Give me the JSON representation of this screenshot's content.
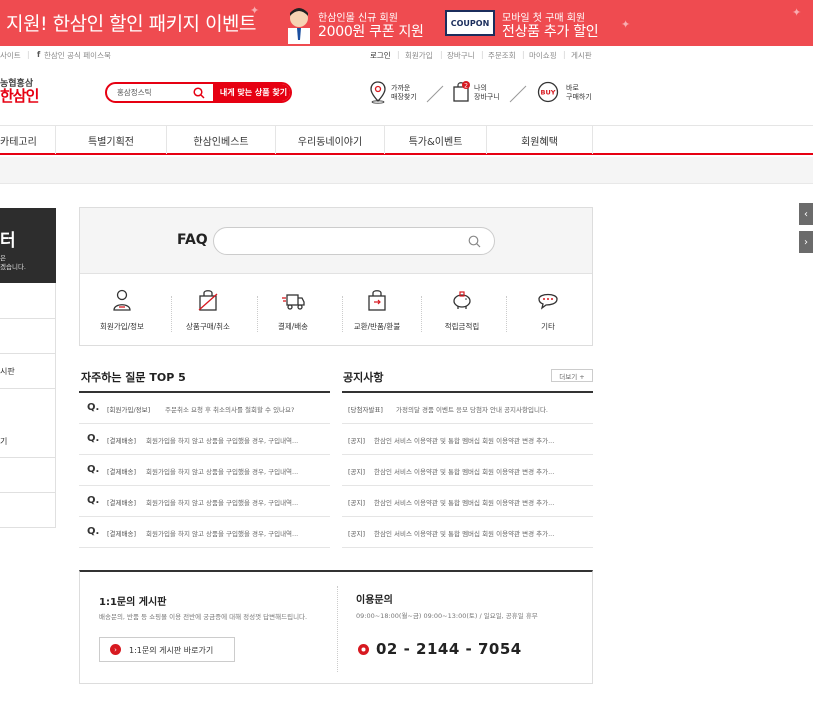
{
  "banner": {
    "title": "지원! 한삼인 할인 패키지 이벤트",
    "promo1_small": "한삼인몰 신규 회원",
    "promo1_big": "2000원 쿠폰 지원",
    "coupon_text": "COUPON",
    "promo2_small": "모바일 첫 구매 회원",
    "promo2_big": "전상품 추가 할인",
    "color": "#ef4b50"
  },
  "util": {
    "left1": "사이트",
    "left2": "한삼인 공식 페이스북",
    "right": [
      "로그인",
      "회원가입",
      "장바구니",
      "주문조회",
      "마이쇼핑",
      "게시판"
    ]
  },
  "logo": {
    "line1": "농협홍삼",
    "line2": "한삼인"
  },
  "search": {
    "keyword": "홍삼정스틱",
    "button": "내게 맞는 상품 찾기"
  },
  "header_icons": [
    {
      "icon": "location-pin-icon",
      "label1": "가까운",
      "label2": "매장찾기"
    },
    {
      "icon": "cart-icon",
      "label1": "나의",
      "label2": "장바구니",
      "badge": "2"
    },
    {
      "icon": "buy-bag-icon",
      "label1": "바로",
      "label2": "구매하기",
      "icon_text": "BUY"
    }
  ],
  "nav": [
    "카테고리",
    "특별기획전",
    "한삼인베스트",
    "우리동네이야기",
    "특가&이벤트",
    "회원혜택"
  ],
  "sidebar": {
    "title": "터",
    "sub1": "은",
    "sub2": "겠습니다.",
    "items": [
      "",
      "",
      "시판",
      "기",
      "",
      ""
    ]
  },
  "faq": {
    "label": "FAQ",
    "categories": [
      {
        "icon": "person-icon",
        "label": "회원가입/정보"
      },
      {
        "icon": "shopping-bag-cancel-icon",
        "label": "상품구매/취소"
      },
      {
        "icon": "delivery-truck-icon",
        "label": "결제/배송"
      },
      {
        "icon": "exchange-bag-icon",
        "label": "교환/반품/환불"
      },
      {
        "icon": "piggy-bank-icon",
        "label": "적립금적립"
      },
      {
        "icon": "speech-bubble-icon",
        "label": "기타"
      }
    ]
  },
  "top5": {
    "title": "자주하는 질문 TOP 5",
    "items": [
      {
        "q": "Q.",
        "cat": "[회원가입/정보]",
        "text": "주문취소 요청 후 취소의사를 철회할 수 있나요?"
      },
      {
        "q": "Q.",
        "cat": "[결제배송]",
        "text": "회원가입을 하지 않고 상품을 구입했을 경우, 구입내역..."
      },
      {
        "q": "Q.",
        "cat": "[결제배송]",
        "text": "회원가입을 하지 않고 상품을 구입했을 경우, 구입내역..."
      },
      {
        "q": "Q.",
        "cat": "[결제배송]",
        "text": "회원가입을 하지 않고 상품을 구입했을 경우, 구입내역..."
      },
      {
        "q": "Q.",
        "cat": "[결제배송]",
        "text": "회원가입을 하지 않고 상품을 구입했을 경우, 구입내역..."
      }
    ]
  },
  "notice": {
    "title": "공지사항",
    "more": "더보기 +",
    "items": [
      {
        "cat": "[당첨자발표]",
        "text": "가정의달 경품 이벤트 응모 당첨자 안내 공지사항입니다."
      },
      {
        "cat": "[공지]",
        "text": "한삼인 서비스 이용약관 및 통합 멤버십 회원 이용약관 변경 추가..."
      },
      {
        "cat": "[공지]",
        "text": "한삼인 서비스 이용약관 및 통합 멤버십 회원 이용약관 변경 추가..."
      },
      {
        "cat": "[공지]",
        "text": "한삼인 서비스 이용약관 및 통합 멤버십 회원 이용약관 변경 추가..."
      },
      {
        "cat": "[공지]",
        "text": "한삼인 서비스 이용약관 및 통합 멤버십 회원 이용약관 변경 추가..."
      }
    ]
  },
  "inquiry": {
    "title": "1:1문의 게시판",
    "desc": "배송문의, 반품 등 쇼핑몰 이용 전반에 궁금증에 대해 정성껏 답변해드립니다.",
    "button": "1:1문의 게시판 바로가기"
  },
  "contact": {
    "title": "이용문의",
    "hours": "09:00~18:00(월~금) 09:00~13:00(토) / 일요일, 공휴일 휴무",
    "phone": "02 - 2144 - 7054"
  }
}
